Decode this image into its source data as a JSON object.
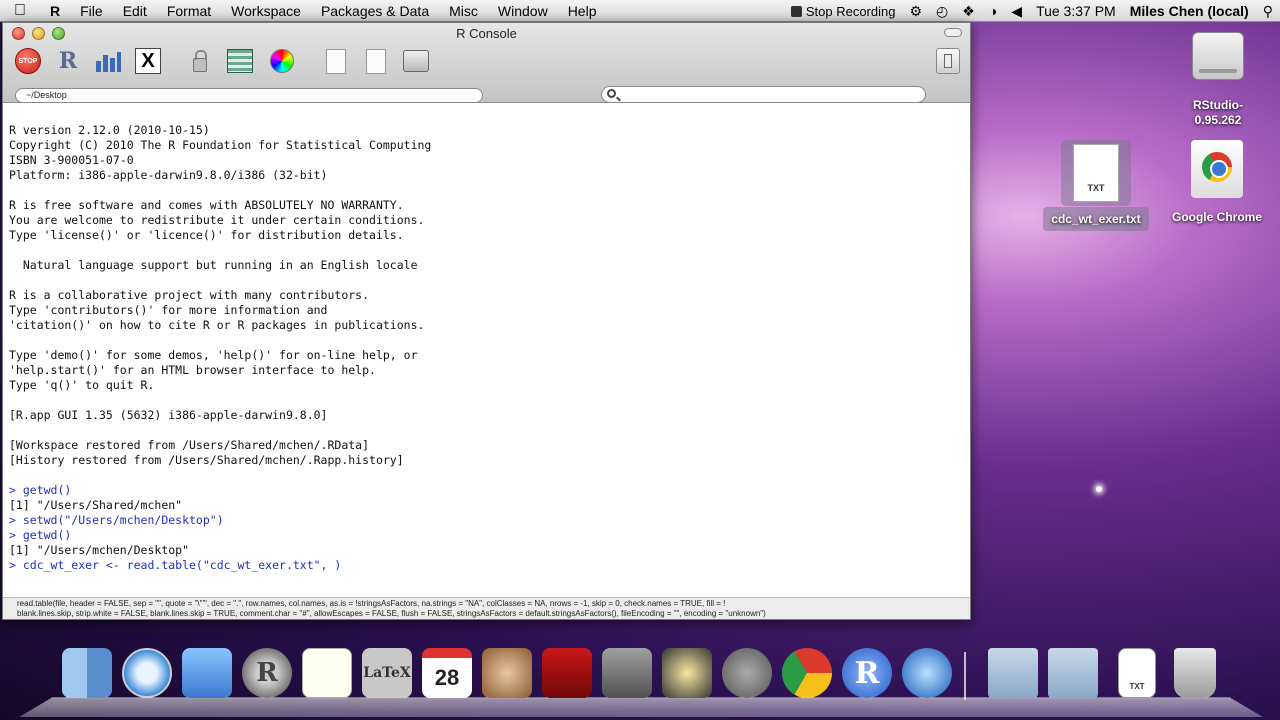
{
  "menubar": {
    "app_name": "R",
    "items": [
      "File",
      "Edit",
      "Format",
      "Workspace",
      "Packages & Data",
      "Misc",
      "Window",
      "Help"
    ],
    "stop_recording": "Stop Recording",
    "clock": "Tue 3:37 PM",
    "user": "Miles Chen (local)"
  },
  "window": {
    "title": "R Console",
    "working_dir": "~/Desktop",
    "search_placeholder": ""
  },
  "toolbar": {
    "stop_label": "STOP"
  },
  "console": {
    "lines": [
      {
        "text": "R version 2.12.0 (2010-10-15)",
        "kind": "out"
      },
      {
        "text": "Copyright (C) 2010 The R Foundation for Statistical Computing",
        "kind": "out"
      },
      {
        "text": "ISBN 3-900051-07-0",
        "kind": "out"
      },
      {
        "text": "Platform: i386-apple-darwin9.8.0/i386 (32-bit)",
        "kind": "out"
      },
      {
        "text": "",
        "kind": "out"
      },
      {
        "text": "R is free software and comes with ABSOLUTELY NO WARRANTY.",
        "kind": "out"
      },
      {
        "text": "You are welcome to redistribute it under certain conditions.",
        "kind": "out"
      },
      {
        "text": "Type 'license()' or 'licence()' for distribution details.",
        "kind": "out"
      },
      {
        "text": "",
        "kind": "out"
      },
      {
        "text": "  Natural language support but running in an English locale",
        "kind": "out"
      },
      {
        "text": "",
        "kind": "out"
      },
      {
        "text": "R is a collaborative project with many contributors.",
        "kind": "out"
      },
      {
        "text": "Type 'contributors()' for more information and",
        "kind": "out"
      },
      {
        "text": "'citation()' on how to cite R or R packages in publications.",
        "kind": "out"
      },
      {
        "text": "",
        "kind": "out"
      },
      {
        "text": "Type 'demo()' for some demos, 'help()' for on-line help, or",
        "kind": "out"
      },
      {
        "text": "'help.start()' for an HTML browser interface to help.",
        "kind": "out"
      },
      {
        "text": "Type 'q()' to quit R.",
        "kind": "out"
      },
      {
        "text": "",
        "kind": "out"
      },
      {
        "text": "[R.app GUI 1.35 (5632) i386-apple-darwin9.8.0]",
        "kind": "out"
      },
      {
        "text": "",
        "kind": "out"
      },
      {
        "text": "[Workspace restored from /Users/Shared/mchen/.RData]",
        "kind": "out"
      },
      {
        "text": "[History restored from /Users/Shared/mchen/.Rapp.history]",
        "kind": "out"
      },
      {
        "text": "",
        "kind": "out"
      },
      {
        "text": "> getwd()",
        "kind": "cmd"
      },
      {
        "text": "[1] \"/Users/Shared/mchen\"",
        "kind": "out"
      },
      {
        "text": "> setwd(\"/Users/mchen/Desktop\")",
        "kind": "cmd"
      },
      {
        "text": "> getwd()",
        "kind": "cmd"
      },
      {
        "text": "[1] \"/Users/mchen/Desktop\"",
        "kind": "out"
      },
      {
        "text": "> cdc_wt_exer <- read.table(\"cdc_wt_exer.txt\", )",
        "kind": "cmd"
      }
    ]
  },
  "statusbar": {
    "line1": "read.table(file, header = FALSE, sep = \"\", quote = \"\\\"'\", dec = \".\", row.names, col.names, as.is = !stringsAsFactors, na.strings = \"NA\", colClasses = NA, nrows = -1, skip = 0, check.names = TRUE, fill = !",
    "line2": "blank.lines.skip, strip.white = FALSE, blank.lines.skip = TRUE, comment.char = \"#\", allowEscapes = FALSE, flush = FALSE, stringsAsFactors = default.stringsAsFactors(), fileEncoding = \"\", encoding = \"unknown\")"
  },
  "desktop": {
    "rstudio_label": "RStudio-0.95.262",
    "txt_file_label": "cdc_wt_exer.txt",
    "txt_badge": "TXT",
    "chrome_label": "Google Chrome"
  },
  "dock": {
    "ical_day": "28",
    "ical_month": "FEB",
    "latex_label": "LaTeX",
    "rapp_label": "R",
    "txt_badge": "TXT"
  }
}
